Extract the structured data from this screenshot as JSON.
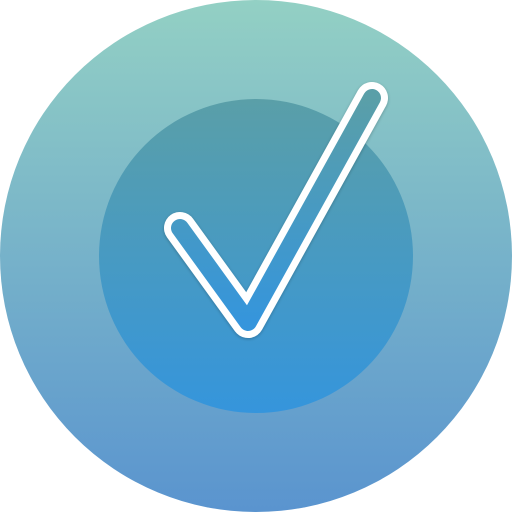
{
  "icon": {
    "name": "checkmark-icon",
    "colors": {
      "outer_top": "#93d0c4",
      "outer_bottom": "#5a94cf",
      "inner_top": "#5a9fa8",
      "inner_bottom": "#3595dc",
      "check_stroke": "#ffffff"
    }
  }
}
